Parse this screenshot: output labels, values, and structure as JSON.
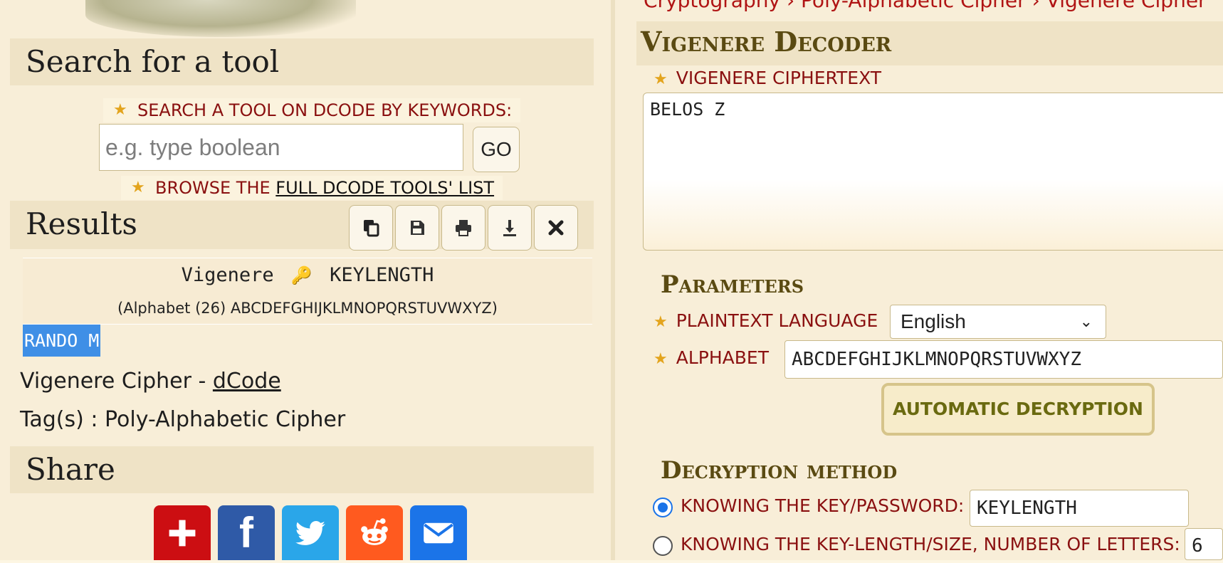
{
  "left": {
    "search": {
      "heading": "Search for a tool",
      "keywords_label": "SEARCH A TOOL ON DCODE BY KEYWORDS:",
      "placeholder": "e.g. type boolean",
      "go_label": "GO",
      "browse_prefix": "BROWSE THE ",
      "browse_link": "FULL DCODE TOOLS' LIST"
    },
    "results": {
      "heading": "Results",
      "tools": [
        "copy-icon",
        "save-icon",
        "print-icon",
        "download-icon",
        "close-icon"
      ],
      "title_left": "Vigenere",
      "key_glyph": "🔑",
      "title_right": "KEYLENGTH",
      "subtitle": "(Alphabet (26) ABCDEFGHIJKLMNOPQRSTUVWXYZ)",
      "output": "RANDO M",
      "source_prefix": "Vigenere Cipher - ",
      "source_link": "dCode",
      "tags": "Tag(s) : Poly-Alphabetic Cipher"
    },
    "share": {
      "heading": "Share",
      "buttons": [
        {
          "icon": "plus-icon",
          "color": "#cc0e12"
        },
        {
          "icon": "facebook-icon",
          "color": "#2f5aa7"
        },
        {
          "icon": "twitter-icon",
          "color": "#2aa6e9"
        },
        {
          "icon": "reddit-icon",
          "color": "#ff5a1f"
        },
        {
          "icon": "mail-icon",
          "color": "#1b74e8"
        }
      ]
    }
  },
  "right": {
    "breadcrumb": "Cryptography › Poly-Alphabetic Cipher › Vigenere Cipher",
    "decoder_title": "Vigenere Decoder",
    "ciphertext_label": "VIGENERE CIPHERTEXT",
    "ciphertext": "BELOS Z",
    "parameters_title": "Parameters",
    "language_label": "PLAINTEXT LANGUAGE",
    "language_value": "English",
    "alphabet_label": "ALPHABET",
    "alphabet_value": "ABCDEFGHIJKLMNOPQRSTUVWXYZ",
    "auto_button": "AUTOMATIC DECRYPTION",
    "method_title": "Decryption method",
    "method_key_label": "KNOWING THE KEY/PASSWORD:",
    "method_key_value": "KEYLENGTH",
    "method_len_label": "KNOWING THE KEY-LENGTH/SIZE, NUMBER OF LETTERS:",
    "method_len_value": "6"
  },
  "colors": {
    "label_red": "#8a1010",
    "title_olive": "#5a4a12",
    "highlight_blue": "#3f8fe6",
    "star_gold": "#e3a41d"
  }
}
